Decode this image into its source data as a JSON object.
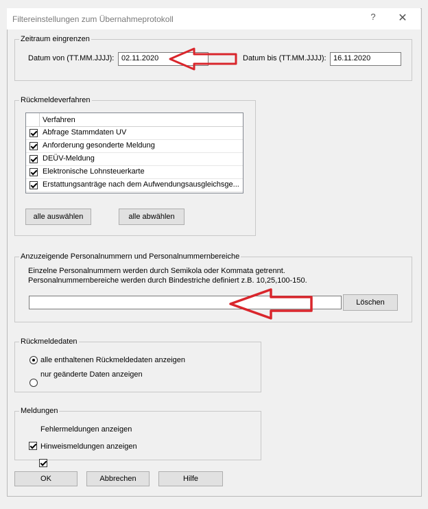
{
  "window": {
    "title": "Filtereinstellungen zum Übernahmeprotokoll",
    "help_glyph": "?",
    "close_glyph": "✕"
  },
  "zeitraum": {
    "legend": "Zeitraum eingrenzen",
    "von_label": "Datum von (TT.MM.JJJJ):",
    "von_value": "02.11.2020",
    "bis_label": "Datum bis (TT.MM.JJJJ):",
    "bis_value": "16.11.2020"
  },
  "rueckmeldeverfahren": {
    "legend": "Rückmeldeverfahren",
    "column_header": "Verfahren",
    "items": [
      {
        "label": "Abfrage Stammdaten UV",
        "checked": true
      },
      {
        "label": "Anforderung gesonderte Meldung",
        "checked": true
      },
      {
        "label": "DEÜV-Meldung",
        "checked": true
      },
      {
        "label": "Elektronische Lohnsteuerkarte",
        "checked": true
      },
      {
        "label": "Erstattungsanträge nach dem Aufwendungsausgleichsge...",
        "checked": true
      }
    ],
    "select_all": "alle auswählen",
    "deselect_all": "alle abwählen"
  },
  "personal": {
    "legend": "Anzuzeigende Personalnummern und Personalnummernbereiche",
    "line1": "Einzelne Personalnummern werden durch Semikola oder Kommata getrennt.",
    "line2": "Personalnummernbereiche werden durch Bindestriche definiert z.B. 10,25,100-150.",
    "input_value": "",
    "delete_button": "Löschen"
  },
  "rueckmeldedaten": {
    "legend": "Rückmeldedaten",
    "options": [
      {
        "label": "alle enthaltenen Rückmeldedaten anzeigen",
        "selected": true
      },
      {
        "label": "nur geänderte Daten anzeigen",
        "selected": false
      }
    ]
  },
  "meldungen": {
    "legend": "Meldungen",
    "options": [
      {
        "label": "Fehlermeldungen anzeigen",
        "checked": true
      },
      {
        "label": "Hinweismeldungen anzeigen",
        "checked": true
      }
    ]
  },
  "footer": {
    "ok": "OK",
    "cancel": "Abbrechen",
    "help": "Hilfe"
  },
  "colors": {
    "arrow": "#d9262c"
  },
  "annotations": [
    {
      "icon": "arrow-left-icon"
    },
    {
      "icon": "arrow-left-icon"
    }
  ]
}
